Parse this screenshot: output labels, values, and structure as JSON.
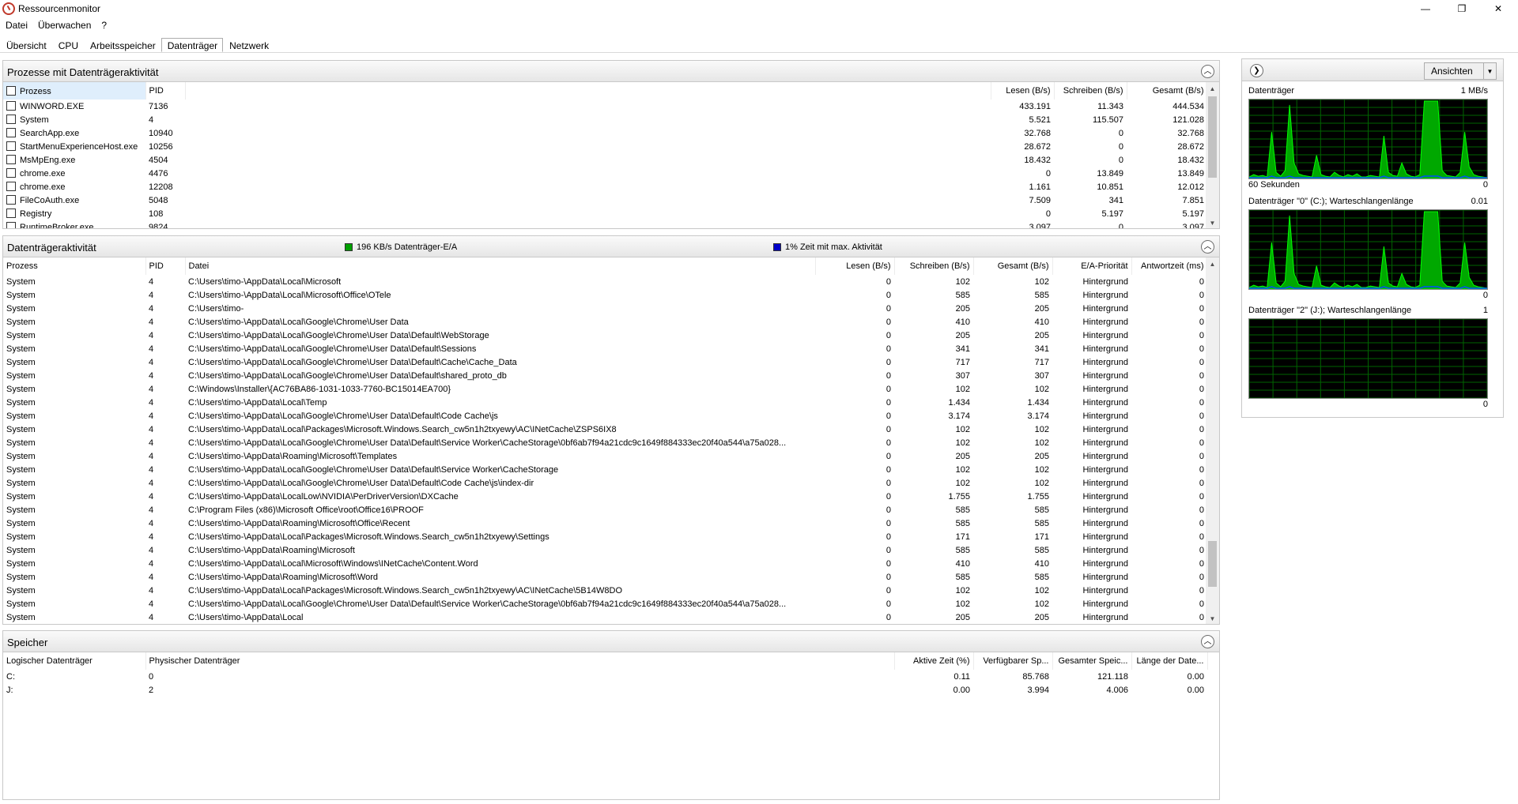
{
  "window": {
    "title": "Ressourcenmonitor",
    "minimize": "—",
    "maximize": "❐",
    "close": "✕"
  },
  "menu": [
    "Datei",
    "Überwachen",
    "?"
  ],
  "tabs": [
    {
      "label": "Übersicht",
      "active": false
    },
    {
      "label": "CPU",
      "active": false
    },
    {
      "label": "Arbeitsspeicher",
      "active": false
    },
    {
      "label": "Datenträger",
      "active": true
    },
    {
      "label": "Netzwerk",
      "active": false
    }
  ],
  "processes": {
    "title": "Prozesse mit Datenträgeraktivität",
    "columns": [
      "Prozess",
      "PID",
      "Lesen (B/s)",
      "Schreiben (B/s)",
      "Gesamt (B/s)"
    ],
    "rows": [
      [
        "WINWORD.EXE",
        "7136",
        "433.191",
        "11.343",
        "444.534"
      ],
      [
        "System",
        "4",
        "5.521",
        "115.507",
        "121.028"
      ],
      [
        "SearchApp.exe",
        "10940",
        "32.768",
        "0",
        "32.768"
      ],
      [
        "StartMenuExperienceHost.exe",
        "10256",
        "28.672",
        "0",
        "28.672"
      ],
      [
        "MsMpEng.exe",
        "4504",
        "18.432",
        "0",
        "18.432"
      ],
      [
        "chrome.exe",
        "4476",
        "0",
        "13.849",
        "13.849"
      ],
      [
        "chrome.exe",
        "12208",
        "1.161",
        "10.851",
        "12.012"
      ],
      [
        "FileCoAuth.exe",
        "5048",
        "7.509",
        "341",
        "7.851"
      ],
      [
        "Registry",
        "108",
        "0",
        "5.197",
        "5.197"
      ],
      [
        "RuntimeBroker.exe",
        "9824",
        "3.097",
        "0",
        "3.097"
      ]
    ]
  },
  "activity": {
    "title": "Datenträgeraktivität",
    "legend_io": "196 KB/s Datenträger-E/A",
    "legend_time": "1% Zeit mit max. Aktivität",
    "io_color": "#00a000",
    "time_color": "#0000c8",
    "columns": [
      "Prozess",
      "PID",
      "Datei",
      "Lesen (B/s)",
      "Schreiben (B/s)",
      "Gesamt (B/s)",
      "E/A-Priorität",
      "Antwortzeit (ms)"
    ],
    "rows": [
      [
        "System",
        "4",
        "C:\\Users\\timo-\\AppData\\Local\\Microsoft",
        "0",
        "102",
        "102",
        "Hintergrund",
        "0"
      ],
      [
        "System",
        "4",
        "C:\\Users\\timo-\\AppData\\Local\\Microsoft\\Office\\OTele",
        "0",
        "585",
        "585",
        "Hintergrund",
        "0"
      ],
      [
        "System",
        "4",
        "C:\\Users\\timo-",
        "0",
        "205",
        "205",
        "Hintergrund",
        "0"
      ],
      [
        "System",
        "4",
        "C:\\Users\\timo-\\AppData\\Local\\Google\\Chrome\\User Data",
        "0",
        "410",
        "410",
        "Hintergrund",
        "0"
      ],
      [
        "System",
        "4",
        "C:\\Users\\timo-\\AppData\\Local\\Google\\Chrome\\User Data\\Default\\WebStorage",
        "0",
        "205",
        "205",
        "Hintergrund",
        "0"
      ],
      [
        "System",
        "4",
        "C:\\Users\\timo-\\AppData\\Local\\Google\\Chrome\\User Data\\Default\\Sessions",
        "0",
        "341",
        "341",
        "Hintergrund",
        "0"
      ],
      [
        "System",
        "4",
        "C:\\Users\\timo-\\AppData\\Local\\Google\\Chrome\\User Data\\Default\\Cache\\Cache_Data",
        "0",
        "717",
        "717",
        "Hintergrund",
        "0"
      ],
      [
        "System",
        "4",
        "C:\\Users\\timo-\\AppData\\Local\\Google\\Chrome\\User Data\\Default\\shared_proto_db",
        "0",
        "307",
        "307",
        "Hintergrund",
        "0"
      ],
      [
        "System",
        "4",
        "C:\\Windows\\Installer\\{AC76BA86-1031-1033-7760-BC15014EA700}",
        "0",
        "102",
        "102",
        "Hintergrund",
        "0"
      ],
      [
        "System",
        "4",
        "C:\\Users\\timo-\\AppData\\Local\\Temp",
        "0",
        "1.434",
        "1.434",
        "Hintergrund",
        "0"
      ],
      [
        "System",
        "4",
        "C:\\Users\\timo-\\AppData\\Local\\Google\\Chrome\\User Data\\Default\\Code Cache\\js",
        "0",
        "3.174",
        "3.174",
        "Hintergrund",
        "0"
      ],
      [
        "System",
        "4",
        "C:\\Users\\timo-\\AppData\\Local\\Packages\\Microsoft.Windows.Search_cw5n1h2txyewy\\AC\\INetCache\\ZSPS6IX8",
        "0",
        "102",
        "102",
        "Hintergrund",
        "0"
      ],
      [
        "System",
        "4",
        "C:\\Users\\timo-\\AppData\\Local\\Google\\Chrome\\User Data\\Default\\Service Worker\\CacheStorage\\0bf6ab7f94a21cdc9c1649f884333ec20f40a544\\a75a028...",
        "0",
        "102",
        "102",
        "Hintergrund",
        "0"
      ],
      [
        "System",
        "4",
        "C:\\Users\\timo-\\AppData\\Roaming\\Microsoft\\Templates",
        "0",
        "205",
        "205",
        "Hintergrund",
        "0"
      ],
      [
        "System",
        "4",
        "C:\\Users\\timo-\\AppData\\Local\\Google\\Chrome\\User Data\\Default\\Service Worker\\CacheStorage",
        "0",
        "102",
        "102",
        "Hintergrund",
        "0"
      ],
      [
        "System",
        "4",
        "C:\\Users\\timo-\\AppData\\Local\\Google\\Chrome\\User Data\\Default\\Code Cache\\js\\index-dir",
        "0",
        "102",
        "102",
        "Hintergrund",
        "0"
      ],
      [
        "System",
        "4",
        "C:\\Users\\timo-\\AppData\\LocalLow\\NVIDIA\\PerDriverVersion\\DXCache",
        "0",
        "1.755",
        "1.755",
        "Hintergrund",
        "0"
      ],
      [
        "System",
        "4",
        "C:\\Program Files (x86)\\Microsoft Office\\root\\Office16\\PROOF",
        "0",
        "585",
        "585",
        "Hintergrund",
        "0"
      ],
      [
        "System",
        "4",
        "C:\\Users\\timo-\\AppData\\Roaming\\Microsoft\\Office\\Recent",
        "0",
        "585",
        "585",
        "Hintergrund",
        "0"
      ],
      [
        "System",
        "4",
        "C:\\Users\\timo-\\AppData\\Local\\Packages\\Microsoft.Windows.Search_cw5n1h2txyewy\\Settings",
        "0",
        "171",
        "171",
        "Hintergrund",
        "0"
      ],
      [
        "System",
        "4",
        "C:\\Users\\timo-\\AppData\\Roaming\\Microsoft",
        "0",
        "585",
        "585",
        "Hintergrund",
        "0"
      ],
      [
        "System",
        "4",
        "C:\\Users\\timo-\\AppData\\Local\\Microsoft\\Windows\\INetCache\\Content.Word",
        "0",
        "410",
        "410",
        "Hintergrund",
        "0"
      ],
      [
        "System",
        "4",
        "C:\\Users\\timo-\\AppData\\Roaming\\Microsoft\\Word",
        "0",
        "585",
        "585",
        "Hintergrund",
        "0"
      ],
      [
        "System",
        "4",
        "C:\\Users\\timo-\\AppData\\Local\\Packages\\Microsoft.Windows.Search_cw5n1h2txyewy\\AC\\INetCache\\5B14W8DO",
        "0",
        "102",
        "102",
        "Hintergrund",
        "0"
      ],
      [
        "System",
        "4",
        "C:\\Users\\timo-\\AppData\\Local\\Google\\Chrome\\User Data\\Default\\Service Worker\\CacheStorage\\0bf6ab7f94a21cdc9c1649f884333ec20f40a544\\a75a028...",
        "0",
        "102",
        "102",
        "Hintergrund",
        "0"
      ],
      [
        "System",
        "4",
        "C:\\Users\\timo-\\AppData\\Local",
        "0",
        "205",
        "205",
        "Hintergrund",
        "0"
      ]
    ]
  },
  "storage": {
    "title": "Speicher",
    "columns": [
      "Logischer Datenträger",
      "Physischer Datenträger",
      "Aktive Zeit (%)",
      "Verfügbarer Sp...",
      "Gesamter Speic...",
      "Länge der Date..."
    ],
    "rows": [
      [
        "C:",
        "0",
        "0.11",
        "85.768",
        "121.118",
        "0.00"
      ],
      [
        "J:",
        "2",
        "0.00",
        "3.994",
        "4.006",
        "0.00"
      ]
    ]
  },
  "right_pane": {
    "views_label": "Ansichten",
    "graphs": [
      {
        "title": "Datenträger",
        "max_label": "1 MB/s",
        "bottom_left": "60 Sekunden",
        "bottom_right": "0",
        "series": [
          2,
          5,
          3,
          4,
          2,
          60,
          8,
          3,
          10,
          95,
          20,
          6,
          4,
          3,
          2,
          30,
          5,
          3,
          2,
          8,
          4,
          2,
          5,
          3,
          6,
          2,
          2,
          4,
          3,
          2,
          55,
          8,
          4,
          3,
          20,
          6,
          3,
          2,
          5,
          100,
          100,
          100,
          100,
          10,
          4,
          3,
          2,
          8,
          60,
          15,
          5,
          3,
          2,
          1
        ]
      },
      {
        "title": "Datenträger \"0\" (C:); Warteschlangenlänge",
        "max_label": "0.01",
        "bottom_left": "",
        "bottom_right": "0",
        "series": [
          2,
          5,
          3,
          4,
          2,
          60,
          8,
          3,
          10,
          95,
          20,
          6,
          4,
          3,
          2,
          30,
          5,
          3,
          2,
          8,
          4,
          2,
          5,
          3,
          6,
          2,
          2,
          4,
          3,
          2,
          55,
          8,
          4,
          3,
          20,
          6,
          3,
          2,
          5,
          100,
          100,
          100,
          100,
          10,
          4,
          3,
          2,
          8,
          60,
          15,
          5,
          3,
          2,
          1
        ]
      },
      {
        "title": "Datenträger \"2\" (J:); Warteschlangenlänge",
        "max_label": "1",
        "bottom_left": "",
        "bottom_right": "0",
        "series": []
      }
    ]
  }
}
